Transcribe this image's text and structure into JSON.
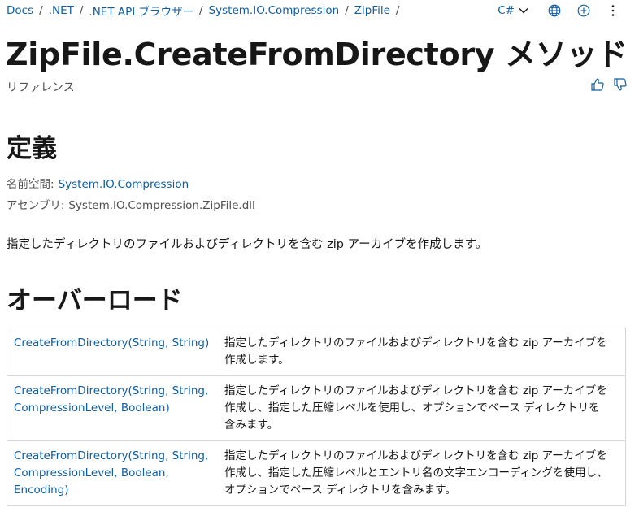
{
  "breadcrumb": {
    "items": [
      "Docs",
      ".NET",
      ".NET API ブラウザー",
      "System.IO.Compression",
      "ZipFile"
    ],
    "separator": "/"
  },
  "toolbar": {
    "language": "C#",
    "icons": [
      "chevron-down-icon",
      "globe-icon",
      "add-icon",
      "more-icon"
    ]
  },
  "page": {
    "title": "ZipFile.CreateFromDirectory メソッド",
    "subtitle": "リファレンス",
    "feedback_icons": [
      "thumbs-up-icon",
      "thumbs-down-icon"
    ]
  },
  "definition": {
    "heading": "定義",
    "namespace_label": "名前空間:",
    "namespace_value": "System.IO.Compression",
    "assembly_label": "アセンブリ:",
    "assembly_value": "System.IO.Compression.ZipFile.dll",
    "description": "指定したディレクトリのファイルおよびディレクトリを含む zip アーカイブを作成します。"
  },
  "overloads": {
    "heading": "オーバーロード",
    "rows": [
      {
        "signature_lines": [
          "CreateFromDirectory(String, String)"
        ],
        "description_lines": [
          "指定したディレクトリのファイルおよびディレクトリを含む zip アーカイブを",
          "作成します。"
        ]
      },
      {
        "signature_lines": [
          "CreateFromDirectory(String, String,",
          "CompressionLevel, Boolean)"
        ],
        "description_lines": [
          "指定したディレクトリのファイルおよびディレクトリを含む zip アーカイブを",
          "作成し、指定した圧縮レベルを使用し、オプションでベース ディレクトリを",
          "含みます。"
        ]
      },
      {
        "signature_lines": [
          "CreateFromDirectory(String, String,",
          "CompressionLevel, Boolean,",
          "Encoding)"
        ],
        "description_lines": [
          "指定したディレクトリのファイルおよびディレクトリを含む zip アーカイブを",
          "作成し、指定した圧縮レベルとエントリ名の文字エンコーディングを使用し、",
          "オプションでベース ディレクトリを含みます。"
        ]
      }
    ]
  },
  "colors": {
    "link": "#0f5fa8",
    "text": "#171717",
    "muted": "#505050",
    "border": "#d5d5d5"
  }
}
